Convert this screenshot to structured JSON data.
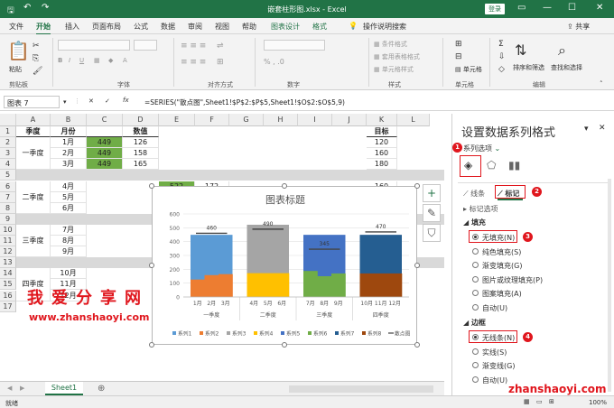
{
  "window": {
    "title": "嵌套柱形图.xlsx - Excel",
    "login": "登录"
  },
  "quick": {
    "undo": "↶",
    "redo": "↷",
    "save": "🖫"
  },
  "tabs": [
    "文件",
    "开始",
    "插入",
    "页面布局",
    "公式",
    "数据",
    "审阅",
    "视图",
    "帮助",
    "图表设计",
    "格式",
    "操作说明搜索"
  ],
  "share": "共享",
  "ribbon": {
    "groups": [
      "剪贴板",
      "字体",
      "对齐方式",
      "数字",
      "样式",
      "单元格",
      "编辑"
    ],
    "paste": "粘贴",
    "style_items": [
      "条件格式",
      "套用表格格式",
      "单元格样式"
    ],
    "cell_items": [
      "单元格"
    ],
    "edit_items": [
      "排序和筛选",
      "查找和选择"
    ]
  },
  "formula_bar": {
    "name_box": "图表 7",
    "fx": "fx",
    "formula": "=SERIES(\"散点图\",Sheet1!$P$2:$P$5,Sheet1!$O$2:$O$5,9)"
  },
  "sheet": {
    "columns": [
      "A",
      "B",
      "C",
      "D",
      "E",
      "F",
      "G",
      "H",
      "I",
      "J",
      "K",
      "L"
    ],
    "rows": [
      "1",
      "2",
      "3",
      "4",
      "5",
      "6",
      "7",
      "8",
      "9",
      "10",
      "11",
      "12",
      "13",
      "14",
      "15",
      "16",
      "17"
    ],
    "headers": {
      "season": "季度",
      "month": "月份",
      "value": "数值",
      "target": "目标"
    },
    "quarters": [
      "一季度",
      "二季度",
      "三季度",
      "四季度"
    ],
    "months": [
      "1月",
      "2月",
      "3月",
      "4月",
      "5月",
      "6月",
      "7月",
      "8月",
      "9月",
      "10月",
      "11月",
      "12月"
    ],
    "c_values": [
      "449",
      "449",
      "449"
    ],
    "d_values": [
      "126",
      "158",
      "165"
    ],
    "e_value": "522",
    "f_value": "172",
    "targets": [
      "120",
      "160",
      "180",
      "120"
    ]
  },
  "chart": {
    "title": "图表标题",
    "yticks": [
      "0",
      "100",
      "200",
      "300",
      "400",
      "500",
      "600"
    ],
    "targets": [
      "460",
      "490",
      "345",
      "470"
    ],
    "categories": [
      "1月",
      "2月",
      "3月",
      "4月",
      "5月",
      "6月",
      "7月",
      "8月",
      "9月",
      "10月",
      "11月",
      "12月"
    ],
    "quarter_labels": [
      "一季度",
      "二季度",
      "三季度",
      "四季度"
    ],
    "legend": [
      "系列1",
      "系列2",
      "系列3",
      "系列4",
      "系列5",
      "系列6",
      "系列7",
      "系列8",
      "散点图"
    ]
  },
  "chart_data": {
    "type": "bar",
    "title": "图表标题",
    "ylim": [
      0,
      600
    ],
    "quarters": [
      "一季度",
      "二季度",
      "三季度",
      "四季度"
    ],
    "segments": [
      {
        "name": "系列1",
        "quarter": "一季度",
        "values": [
          449,
          449,
          449
        ],
        "low": [],
        "color": "#5b9bd5"
      },
      {
        "name": "系列2",
        "quarter": "一季度",
        "values": [
          126,
          158,
          165
        ],
        "color": "#ed7d31"
      },
      {
        "name": "系列3",
        "quarter": "二季度",
        "values": [
          522,
          522,
          522
        ],
        "color": "#a5a5a5"
      },
      {
        "name": "系列4",
        "quarter": "二季度",
        "values": [
          172,
          172,
          172
        ],
        "color": "#ffc000"
      },
      {
        "name": "系列5",
        "quarter": "三季度",
        "values": [
          449,
          449,
          449
        ],
        "color": "#4472c4"
      },
      {
        "name": "系列6",
        "quarter": "三季度",
        "values": [
          188,
          150,
          170
        ],
        "color": "#70ad47"
      },
      {
        "name": "系列7",
        "quarter": "四季度",
        "values": [
          449,
          449,
          449
        ],
        "color": "#255e91"
      },
      {
        "name": "系列8",
        "quarter": "四季度",
        "values": [
          170,
          170,
          170
        ],
        "color": "#9e480e"
      }
    ],
    "scatter": {
      "name": "散点图",
      "values": [
        460,
        490,
        345,
        470
      ]
    }
  },
  "watermark": {
    "text": "我爱分享网",
    "url": "www.zhanshaoyi.com",
    "corner": "zhanshaoyi.com"
  },
  "sheet_tab": "Sheet1",
  "status": {
    "left": "就绪",
    "zoom": "100%"
  },
  "pane": {
    "title": "设置数据系列格式",
    "series_options": "系列选项",
    "tab_line": "线条",
    "tab_marker": "标记",
    "marker_options": "标记选项",
    "fill_section": "填充",
    "fill_options": [
      "无填充(N)",
      "纯色填充(S)",
      "渐变填充(G)",
      "图片或纹理填充(P)",
      "图案填充(A)",
      "自动(U)"
    ],
    "border_section": "边框",
    "border_options": [
      "无线条(N)",
      "实线(S)",
      "渐变线(G)",
      "自动(U)"
    ],
    "badges": [
      "1",
      "2",
      "3",
      "4"
    ]
  }
}
